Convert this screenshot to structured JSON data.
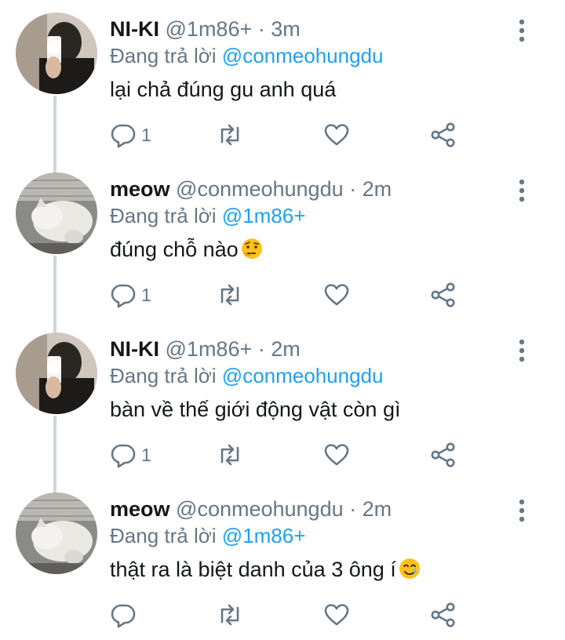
{
  "reply_prefix": "Đang trả lời",
  "tweets": [
    {
      "name": "NI-KI",
      "handle": "@1m86+",
      "separator": "·",
      "time": "3m",
      "reply_to": "@conmeohungdu",
      "text": "lại chả đúng gu anh quá",
      "reply_count": "1",
      "avatar": "person-selfie-avatar"
    },
    {
      "name": "meow",
      "handle": "@conmeohungdu",
      "separator": "·",
      "time": "2m",
      "reply_to": "@1m86+",
      "text": "đúng chỗ nào",
      "emoji": "face-with-raised-eyebrow",
      "reply_count": "1",
      "avatar": "white-cat-avatar"
    },
    {
      "name": "NI-KI",
      "handle": "@1m86+",
      "separator": "·",
      "time": "2m",
      "reply_to": "@conmeohungdu",
      "text": "bàn về thế giới động vật còn gì",
      "reply_count": "1",
      "avatar": "person-selfie-avatar"
    },
    {
      "name": "meow",
      "handle": "@conmeohungdu",
      "separator": "·",
      "time": "2m",
      "reply_to": "@1m86+",
      "text": "thật ra là biệt danh của 3 ông í",
      "emoji": "smiling-face-with-tear",
      "reply_count": "",
      "avatar": "white-cat-avatar"
    }
  ],
  "colors": {
    "link": "#1da1f2",
    "secondary_text": "#657786",
    "thread_line": "#ccd6dd"
  }
}
